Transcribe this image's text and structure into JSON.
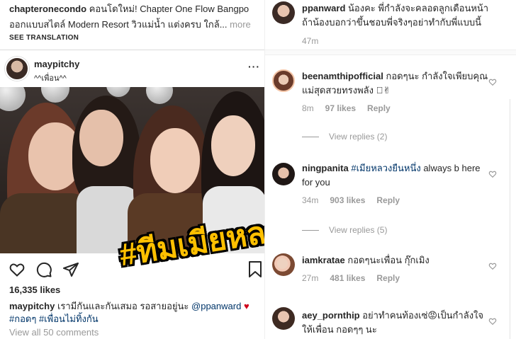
{
  "left": {
    "top_caption": {
      "user": "chapteronecondo",
      "text": "คอนโดใหม่! Chapter One Flow Bangpo ออกแบบสไตล์ Modern Resort วิวแม่น้ำ แต่งครบ ใกล้...",
      "more": "more",
      "see_translation": "SEE TRANSLATION"
    },
    "post": {
      "username": "maypitchy",
      "location": "^^เพื่อน^^",
      "more_label": "···",
      "overlay_text": "#ทีมเมียหลวง",
      "likes": "16,335 likes",
      "caption_user": "maypitchy",
      "caption_text": "เรามีกันและกันเสมอ รอสายอยู่นะ",
      "caption_mention": "@ppanward",
      "caption_heart": "♥",
      "caption_tags": "#กอดๆ #เพื่อนไม่ทิ้งกัน",
      "view_all": "View all 50 comments"
    }
  },
  "right": {
    "comments": [
      {
        "user": "ppanward",
        "text": "น้องคะ พี่กำลังจะคลอดลูกเดือนหน้า ถ้าน้องบอกว่าขึ้นชอบพี่จริงๆอย่าทำกับพี่แบบนี้",
        "time": "47m",
        "likes": "",
        "reply": ""
      },
      {
        "user": "beenamthipofficial",
        "text": "กอดๆนะ กำลังใจเพียบคุณแม่สุดสวยทรงพลัง 🏻✌",
        "time": "8m",
        "likes": "97 likes",
        "reply": "Reply",
        "view_replies": "View replies (2)"
      },
      {
        "user": "ningpanita",
        "tag": "#เมียหลวงยืนหนึ่ง",
        "text": "always b here for you",
        "time": "34m",
        "likes": "903 likes",
        "reply": "Reply",
        "view_replies": "View replies (5)"
      },
      {
        "user": "iamkratae",
        "text": "กอดๆนะเพื่อน กุ๊กเมิง",
        "time": "27m",
        "likes": "481 likes",
        "reply": "Reply"
      },
      {
        "user": "aey_pornthip",
        "text": "อย่าทำคนท้องเซ่😡เป็นกำลังใจให้เพื่อน กอดๆๆ นะ",
        "time": "",
        "likes": "",
        "reply": ""
      }
    ]
  },
  "colors": {
    "link": "#003569",
    "muted": "#999999",
    "stamp_yellow": "#ffc000",
    "heart_red": "#d0021b"
  }
}
